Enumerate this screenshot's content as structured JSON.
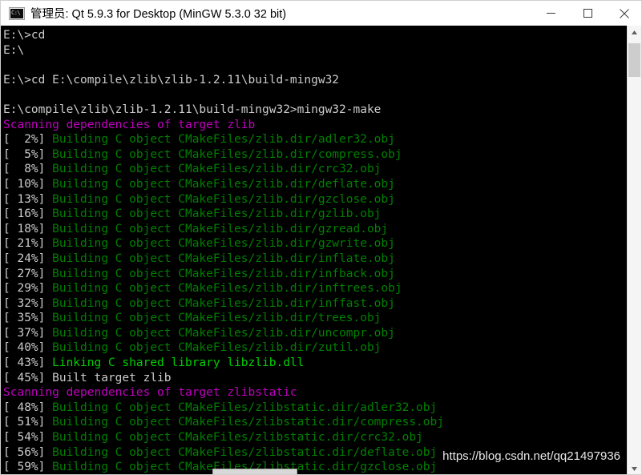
{
  "window": {
    "title": "管理员: Qt 5.9.3 for Desktop (MinGW 5.3.0 32 bit)",
    "icon": "cmd-console-icon",
    "icon_glyph": "C:\\",
    "minimize_label": "Minimize",
    "maximize_label": "Maximize",
    "close_label": "Close"
  },
  "console": {
    "background_color": "#000000",
    "default_text_color": "#cccccc",
    "green_color": "#008000",
    "bright_green_color": "#00d000",
    "magenta_color": "#bf00bf",
    "lines": [
      {
        "segments": [
          {
            "text": "E:\\>cd",
            "color": "white"
          }
        ]
      },
      {
        "segments": [
          {
            "text": "E:\\",
            "color": "white"
          }
        ]
      },
      {
        "segments": [
          {
            "text": "",
            "color": "white"
          }
        ]
      },
      {
        "segments": [
          {
            "text": "E:\\>cd E:\\compile\\zlib\\zlib-1.2.11\\build-mingw32",
            "color": "white"
          }
        ]
      },
      {
        "segments": [
          {
            "text": "",
            "color": "white"
          }
        ]
      },
      {
        "segments": [
          {
            "text": "E:\\compile\\zlib\\zlib-1.2.11\\build-mingw32>mingw32-make",
            "color": "white"
          }
        ]
      },
      {
        "segments": [
          {
            "text": "Scanning dependencies of target zlib",
            "color": "magenta"
          }
        ]
      },
      {
        "segments": [
          {
            "text": "[  2%] ",
            "color": "white"
          },
          {
            "text": "Building C object CMakeFiles/zlib.dir/adler32.obj",
            "color": "green"
          }
        ]
      },
      {
        "segments": [
          {
            "text": "[  5%] ",
            "color": "white"
          },
          {
            "text": "Building C object CMakeFiles/zlib.dir/compress.obj",
            "color": "green"
          }
        ]
      },
      {
        "segments": [
          {
            "text": "[  8%] ",
            "color": "white"
          },
          {
            "text": "Building C object CMakeFiles/zlib.dir/crc32.obj",
            "color": "green"
          }
        ]
      },
      {
        "segments": [
          {
            "text": "[ 10%] ",
            "color": "white"
          },
          {
            "text": "Building C object CMakeFiles/zlib.dir/deflate.obj",
            "color": "green"
          }
        ]
      },
      {
        "segments": [
          {
            "text": "[ 13%] ",
            "color": "white"
          },
          {
            "text": "Building C object CMakeFiles/zlib.dir/gzclose.obj",
            "color": "green"
          }
        ]
      },
      {
        "segments": [
          {
            "text": "[ 16%] ",
            "color": "white"
          },
          {
            "text": "Building C object CMakeFiles/zlib.dir/gzlib.obj",
            "color": "green"
          }
        ]
      },
      {
        "segments": [
          {
            "text": "[ 18%] ",
            "color": "white"
          },
          {
            "text": "Building C object CMakeFiles/zlib.dir/gzread.obj",
            "color": "green"
          }
        ]
      },
      {
        "segments": [
          {
            "text": "[ 21%] ",
            "color": "white"
          },
          {
            "text": "Building C object CMakeFiles/zlib.dir/gzwrite.obj",
            "color": "green"
          }
        ]
      },
      {
        "segments": [
          {
            "text": "[ 24%] ",
            "color": "white"
          },
          {
            "text": "Building C object CMakeFiles/zlib.dir/inflate.obj",
            "color": "green"
          }
        ]
      },
      {
        "segments": [
          {
            "text": "[ 27%] ",
            "color": "white"
          },
          {
            "text": "Building C object CMakeFiles/zlib.dir/infback.obj",
            "color": "green"
          }
        ]
      },
      {
        "segments": [
          {
            "text": "[ 29%] ",
            "color": "white"
          },
          {
            "text": "Building C object CMakeFiles/zlib.dir/inftrees.obj",
            "color": "green"
          }
        ]
      },
      {
        "segments": [
          {
            "text": "[ 32%] ",
            "color": "white"
          },
          {
            "text": "Building C object CMakeFiles/zlib.dir/inffast.obj",
            "color": "green"
          }
        ]
      },
      {
        "segments": [
          {
            "text": "[ 35%] ",
            "color": "white"
          },
          {
            "text": "Building C object CMakeFiles/zlib.dir/trees.obj",
            "color": "green"
          }
        ]
      },
      {
        "segments": [
          {
            "text": "[ 37%] ",
            "color": "white"
          },
          {
            "text": "Building C object CMakeFiles/zlib.dir/uncompr.obj",
            "color": "green"
          }
        ]
      },
      {
        "segments": [
          {
            "text": "[ 40%] ",
            "color": "white"
          },
          {
            "text": "Building C object CMakeFiles/zlib.dir/zutil.obj",
            "color": "green"
          }
        ]
      },
      {
        "segments": [
          {
            "text": "[ 43%] ",
            "color": "white"
          },
          {
            "text": "Linking C shared library libzlib.dll",
            "color": "brgreen"
          }
        ]
      },
      {
        "segments": [
          {
            "text": "[ 45%] Built target zlib",
            "color": "white"
          }
        ]
      },
      {
        "segments": [
          {
            "text": "Scanning dependencies of target zlibstatic",
            "color": "magenta"
          }
        ]
      },
      {
        "segments": [
          {
            "text": "[ 48%] ",
            "color": "white"
          },
          {
            "text": "Building C object CMakeFiles/zlibstatic.dir/adler32.obj",
            "color": "green"
          }
        ]
      },
      {
        "segments": [
          {
            "text": "[ 51%] ",
            "color": "white"
          },
          {
            "text": "Building C object CMakeFiles/zlibstatic.dir/compress.obj",
            "color": "green"
          }
        ]
      },
      {
        "segments": [
          {
            "text": "[ 54%] ",
            "color": "white"
          },
          {
            "text": "Building C object CMakeFiles/zlibstatic.dir/crc32.obj",
            "color": "green"
          }
        ]
      },
      {
        "segments": [
          {
            "text": "[ 56%] ",
            "color": "white"
          },
          {
            "text": "Building C object CMakeFiles/zlibstatic.dir/deflate.obj",
            "color": "green"
          }
        ]
      },
      {
        "segments": [
          {
            "text": "[ 59%] ",
            "color": "white"
          },
          {
            "text": "Building C object CMakeFiles/zlibstatic.dir/gzclose.obj",
            "color": "green"
          }
        ]
      }
    ]
  },
  "watermark": {
    "text": "https://blog.csdn.net/qq21497936"
  }
}
